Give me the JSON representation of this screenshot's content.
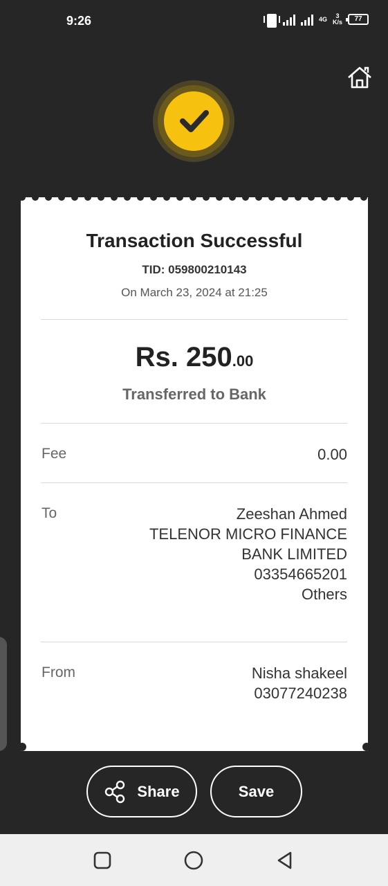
{
  "status_bar": {
    "time": "9:26",
    "network": "4G",
    "speed_value": "3",
    "speed_unit": "K/s",
    "battery": "77"
  },
  "icons": {
    "home": "home-icon",
    "check": "check-icon",
    "share": "share-icon",
    "recent": "recent-apps-icon",
    "nav_home": "nav-home-icon",
    "back": "back-icon"
  },
  "colors": {
    "background": "#262626",
    "accent": "#f7c20f",
    "receipt": "#ffffff"
  },
  "receipt": {
    "title": "Transaction Successful",
    "tid": "TID: 059800210143",
    "date": "On March 23, 2024 at 21:25",
    "amount_main": "Rs. 250",
    "amount_cents": ".00",
    "subtitle": "Transferred to Bank",
    "fee": {
      "label": "Fee",
      "value": "0.00"
    },
    "to": {
      "label": "To",
      "lines": [
        "Zeeshan Ahmed",
        "TELENOR MICRO FINANCE",
        "BANK LIMITED",
        "03354665201",
        "Others"
      ]
    },
    "from": {
      "label": "From",
      "lines": [
        "Nisha shakeel",
        "03077240238"
      ]
    }
  },
  "actions": {
    "share_label": "Share",
    "save_label": "Save"
  }
}
